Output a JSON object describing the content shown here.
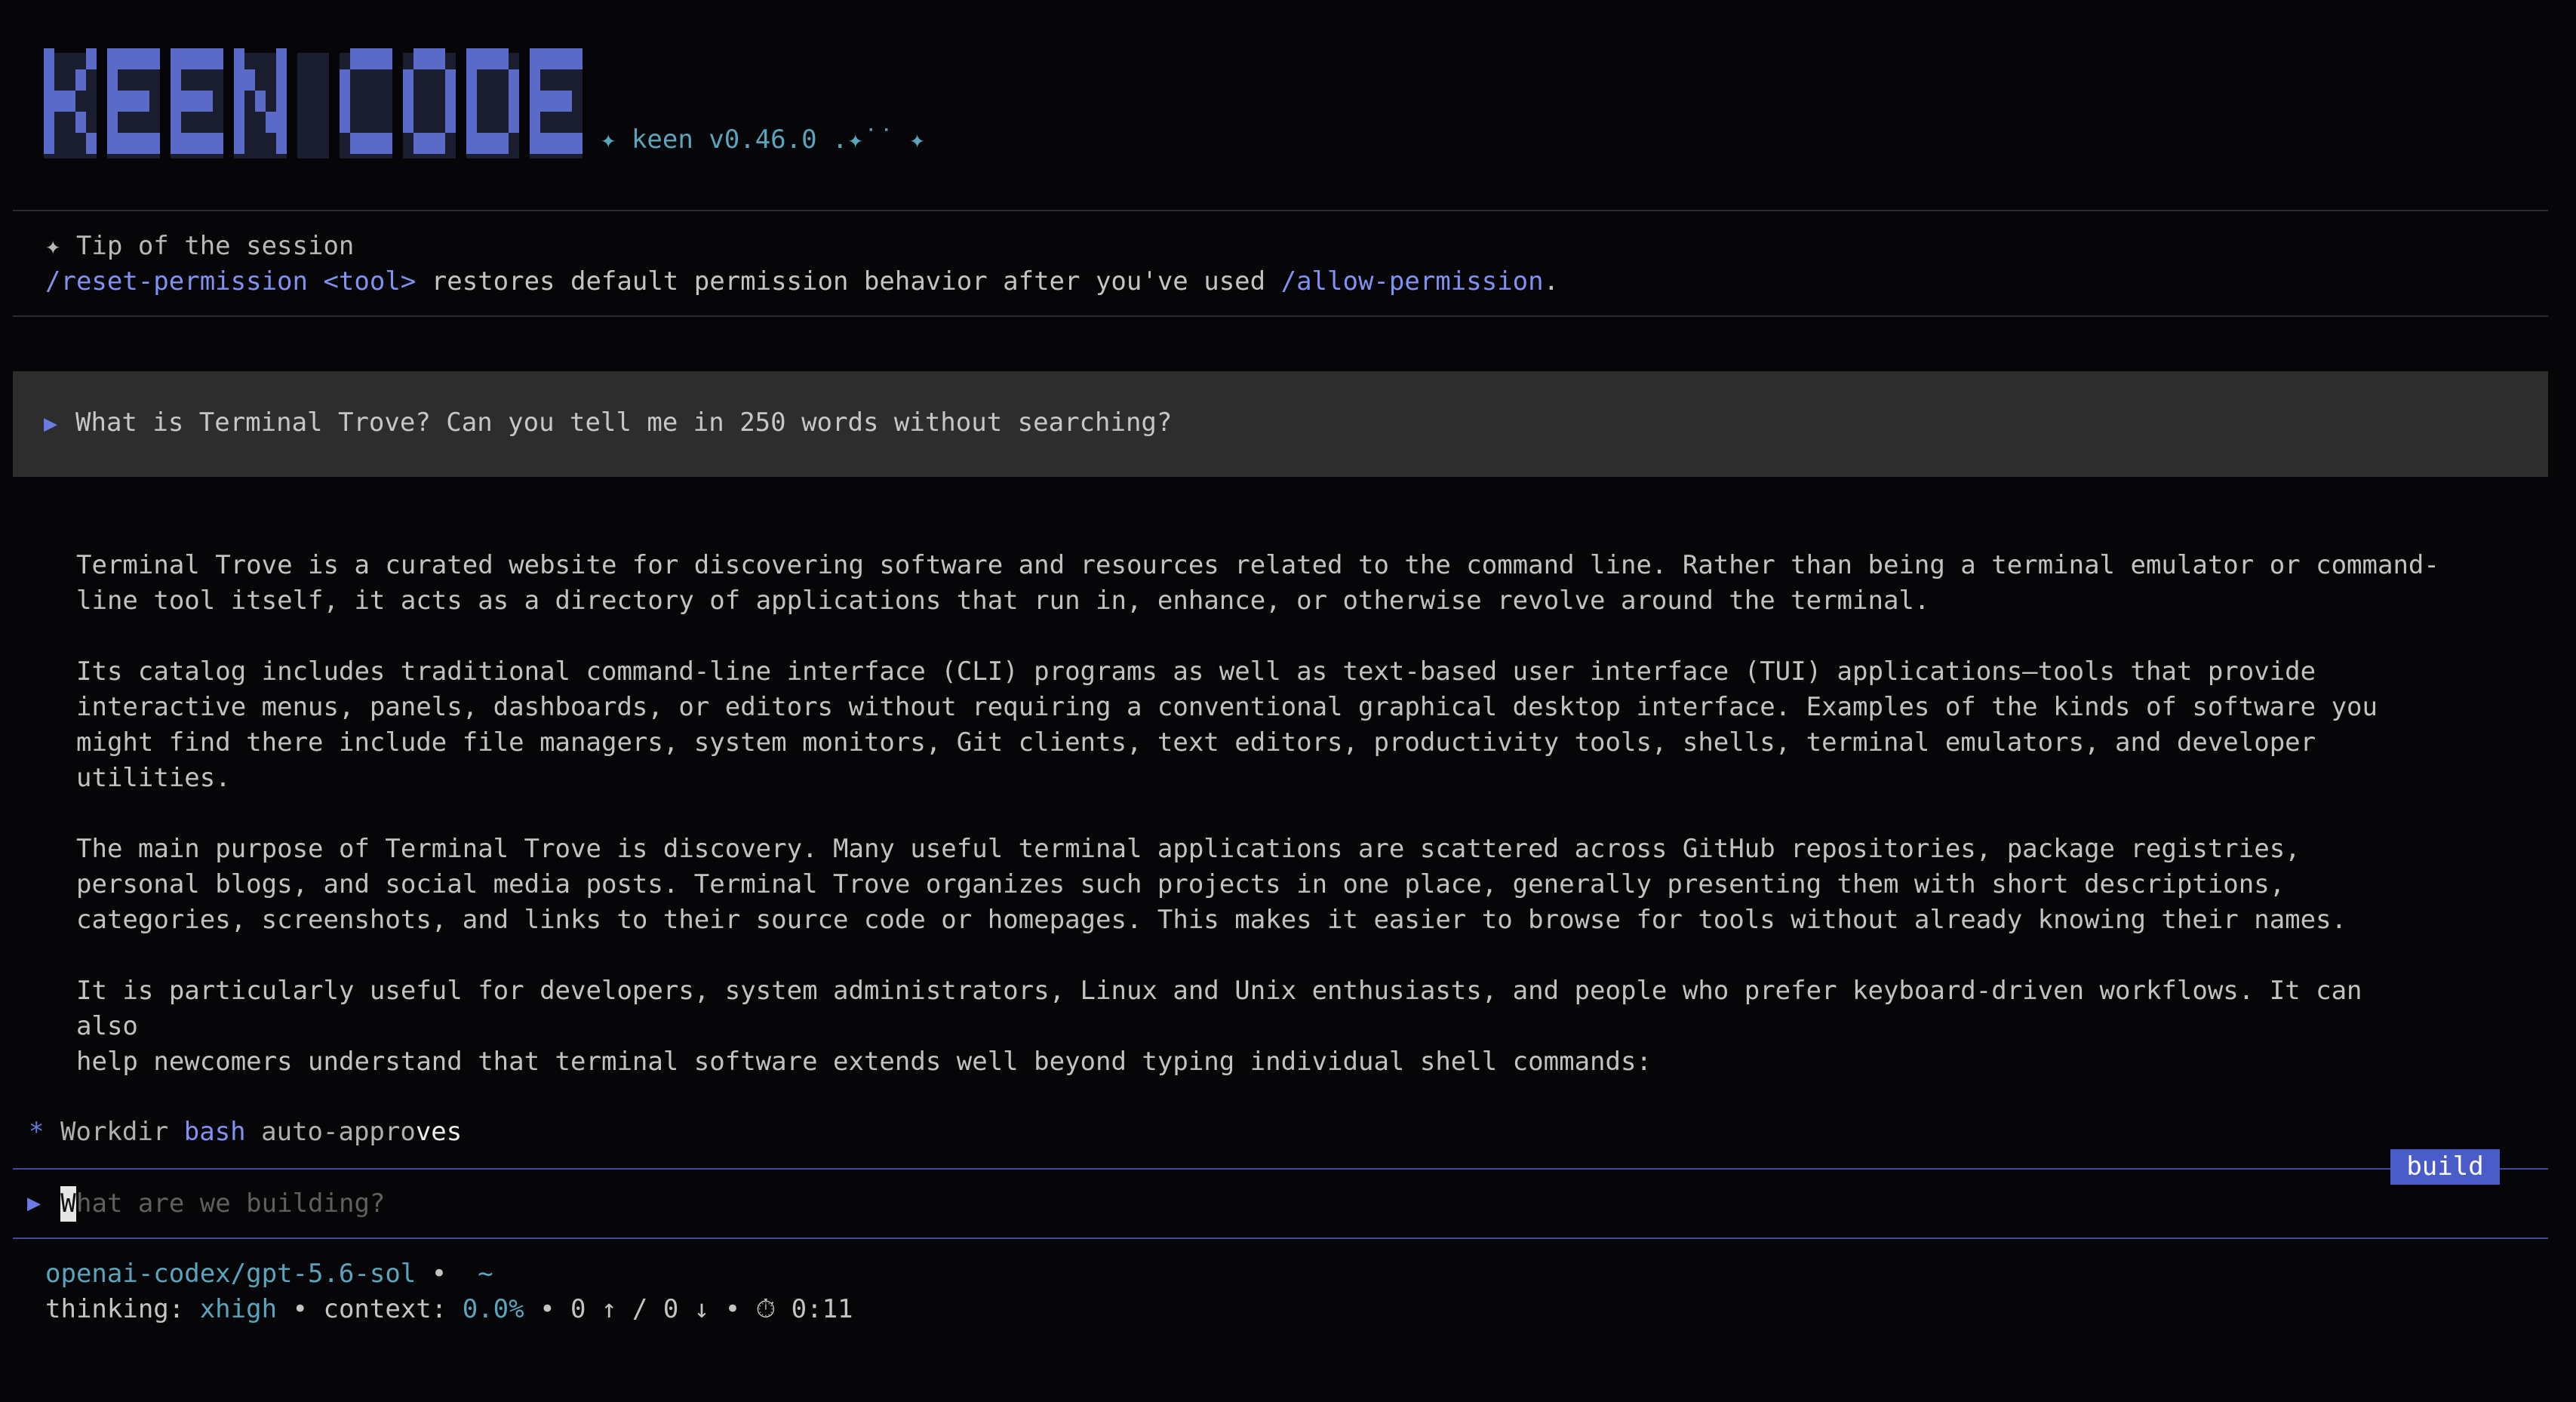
{
  "header": {
    "logo_text": "KEEN CODE",
    "version_text": "✦ keen v0.46.0 .✦˙˙ ✦"
  },
  "tip": {
    "title": "✦ Tip of the session",
    "command": "/reset-permission <tool>",
    "middle_text": " restores default permission behavior after you've used ",
    "link": "/allow-permission",
    "end": "."
  },
  "user_prompt": {
    "marker": "▶",
    "text": "What is Terminal Trove? Can you tell me in 250 words without searching?"
  },
  "response": {
    "paragraphs": [
      [
        "Terminal Trove is a curated website for discovering software and resources related to the command line. Rather than being a terminal emulator or command-",
        "line tool itself, it acts as a directory of applications that run in, enhance, or otherwise revolve around the terminal."
      ],
      [
        "Its catalog includes traditional command-line interface (CLI) programs as well as text-based user interface (TUI) applications—tools that provide",
        "interactive menus, panels, dashboards, or editors without requiring a conventional graphical desktop interface. Examples of the kinds of software you",
        "might find there include file managers, system monitors, Git clients, text editors, productivity tools, shells, terminal emulators, and developer",
        "utilities."
      ],
      [
        "The main purpose of Terminal Trove is discovery. Many useful terminal applications are scattered across GitHub repositories, package registries,",
        "personal blogs, and social media posts. Terminal Trove organizes such projects in one place, generally presenting them with short descriptions,",
        "categories, screenshots, and links to their source code or homepages. This makes it easier to browse for tools without already knowing their names."
      ],
      [
        "It is particularly useful for developers, system administrators, Linux and Unix enthusiasts, and people who prefer keyboard-driven workflows. It can",
        "also",
        "help newcomers understand that terminal software extends well beyond typing individual shell commands:"
      ]
    ]
  },
  "status": {
    "star": "*",
    "prefix": "Workdir ",
    "bash": "bash",
    "suffix_dim": " auto-appro",
    "suffix_bright": "ves"
  },
  "mode_badge": "build",
  "input": {
    "marker": "▶",
    "cursor_char": "W",
    "placeholder": "hat are we building?"
  },
  "footer": {
    "model": "openai-codex/gpt-5.6-sol",
    "model_sep": " •  ",
    "cwd": "~",
    "thinking_label": "thinking: ",
    "thinking_value": "xhigh",
    "context_label": " • context: ",
    "context_value": "0.0%",
    "tokens": " • 0 ↑ / 0 ↓ • ",
    "timer_icon": "⏱",
    "timer": " 0:11"
  },
  "colors": {
    "background": "#060608",
    "accent_blue": "#8290f0",
    "logo_blue": "#5b69c9",
    "teal": "#5aa5bd",
    "badge": "#4a5cc8"
  }
}
